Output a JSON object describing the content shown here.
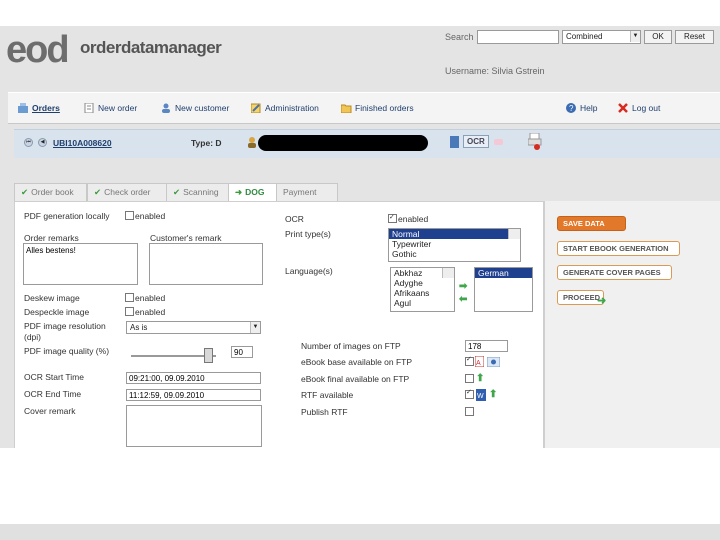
{
  "header": {
    "logo_main": "eod",
    "logo_text": "orderdatamanager",
    "search_label": "Search",
    "search_value": "",
    "search_mode": "Combined",
    "ok_label": "OK",
    "reset_label": "Reset",
    "username_label": "Username: Silvia Gstrein"
  },
  "nav": {
    "orders": "Orders",
    "new_order": "New order",
    "new_customer": "New customer",
    "administration": "Administration",
    "finished_orders": "Finished orders",
    "help": "Help",
    "logout": "Log out"
  },
  "record": {
    "id": "UBI10A008620",
    "type_label": "Type: D",
    "ocr_label": "OCR"
  },
  "tabs": [
    {
      "label": "Order book",
      "done": true
    },
    {
      "label": "Check order",
      "done": true
    },
    {
      "label": "Scanning",
      "done": true
    },
    {
      "label": "DOG",
      "active": true
    },
    {
      "label": "Payment"
    }
  ],
  "left_form": {
    "pdf_generation_label": "PDF generation locally",
    "enabled": "enabled",
    "order_remarks_label": "Order remarks",
    "order_remarks_value": "Alles bestens!",
    "customers_remark_label": "Customer's remark",
    "customers_remark_value": "",
    "deskew_label": "Deskew image",
    "despeckle_label": "Despeckle image",
    "pdf_resolution_label": "PDF image resolution",
    "pdf_resolution_unit": "(dpi)",
    "pdf_resolution_value": "As is",
    "pdf_quality_label": "PDF image quality (%)",
    "pdf_quality_value": "90",
    "pdf_quality_level": 0.9,
    "ocr_start_label": "OCR Start Time",
    "ocr_start_value": "09:21:00, 09.09.2010",
    "ocr_end_label": "OCR End Time",
    "ocr_end_value": "11:12:59, 09.09.2010",
    "cover_remark_label": "Cover remark",
    "cover_remark_value": ""
  },
  "mid_form": {
    "ocr_label": "OCR",
    "ocr_enabled": "enabled",
    "print_type_label": "Print type(s)",
    "print_types": [
      "Normal",
      "Typewriter",
      "Gothic"
    ],
    "language_label": "Language(s)",
    "languages_available": [
      "Abkhaz",
      "Adyghe",
      "Afrikaans",
      "Agul"
    ],
    "languages_selected": [
      "German"
    ],
    "num_images_label": "Number of images on FTP",
    "num_images_value": "178",
    "ebook_base_label": "eBook base available on FTP",
    "ebook_final_label": "eBook final available on FTP",
    "rtf_available_label": "RTF available",
    "publish_rtf_label": "Publish RTF"
  },
  "actions": {
    "save": "SAVE DATA",
    "start_ebook": "START EBOOK GENERATION",
    "cover_pages": "GENERATE COVER PAGES",
    "proceed": "PROCEED"
  },
  "colors": {
    "nav_text": "#1f3f6d",
    "accent": "#e2782a",
    "tab_active": "#2e8b3e"
  }
}
